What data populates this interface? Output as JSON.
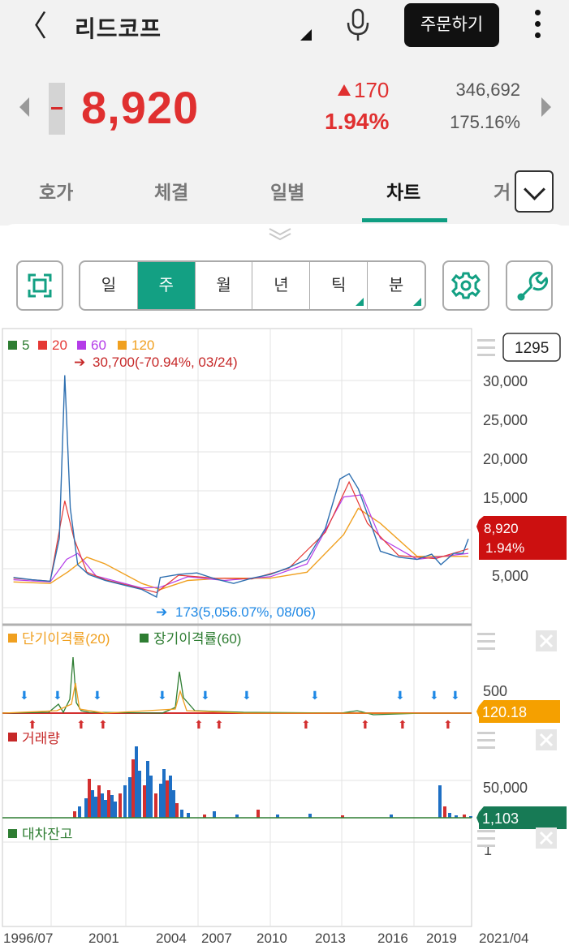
{
  "header": {
    "back_glyph": "〈",
    "stock_name": "리드코프",
    "order_button": "주문하기"
  },
  "quote": {
    "price": "8,920",
    "change": "170",
    "change_pct": "1.94%",
    "volume": "346,692",
    "turnover": "175.16%",
    "color_up": "#e03030"
  },
  "tabs": [
    {
      "label": "호가"
    },
    {
      "label": "체결"
    },
    {
      "label": "일별"
    },
    {
      "label": "차트"
    },
    {
      "label": "거"
    }
  ],
  "active_tab": "차트",
  "toolbar": {
    "periods": [
      "일",
      "주",
      "월",
      "년",
      "틱",
      "분"
    ],
    "active_period": "주",
    "accent": "#13a083"
  },
  "chart": {
    "count_box": "1295",
    "price_panel": {
      "legend": [
        {
          "label": "5",
          "color": "#2e7d32"
        },
        {
          "label": "20",
          "color": "#e53935"
        },
        {
          "label": "60",
          "color": "#b43ce8"
        },
        {
          "label": "120",
          "color": "#f0a020"
        }
      ],
      "high_annotation": "30,700(-70.94%, 03/24)",
      "low_annotation": "173(5,056.07%, 08/06)",
      "y_ticks": [
        "30,000",
        "25,000",
        "20,000",
        "15,000",
        "5,000"
      ],
      "current_price_tag": "8,920",
      "current_pct_tag": "1.94%"
    },
    "disparity_panel": {
      "legend_short": "단기이격률(20)",
      "legend_long": "장기이격률(60)",
      "y_tick": "500",
      "value_tag": "120.18"
    },
    "volume_panel": {
      "legend": "거래량",
      "y_tick": "50,000",
      "value_tag": "1,103"
    },
    "loan_panel": {
      "legend": "대차잔고",
      "y_tick": "1"
    },
    "x_ticks": [
      "1996/07",
      "2001",
      "2004",
      "2007",
      "2010",
      "2013",
      "2016",
      "2019",
      "2021/04"
    ]
  },
  "chart_data": {
    "type": "line",
    "title": "",
    "x_ticks": [
      "1996/07",
      "2001",
      "2004",
      "2007",
      "2010",
      "2013",
      "2016",
      "2019",
      "2021/04"
    ],
    "ylim": [
      0,
      32000
    ],
    "series": [
      {
        "name": "5",
        "x": [
          1996.5,
          1997.5,
          1998.5,
          1999.0,
          1999.3,
          1999.6,
          2000.0,
          2000.6,
          2001.5,
          2002.5,
          2003.5,
          2004.3,
          2004.5,
          2005.5,
          2006.5,
          2007.5,
          2008.5,
          2009.5,
          2010.5,
          2011.5,
          2012.5,
          2013.5,
          2014.3,
          2014.8,
          2015.3,
          2015.8,
          2016.5,
          2017.5,
          2018.5,
          2019.3,
          2019.8,
          2020.5,
          2021.0,
          2021.3
        ],
        "values": [
          3800,
          3500,
          3300,
          9000,
          30700,
          13000,
          5500,
          4200,
          3400,
          2800,
          2200,
          1200,
          3800,
          4200,
          4400,
          3600,
          3000,
          3700,
          4200,
          5100,
          6200,
          10300,
          16900,
          17600,
          15600,
          12200,
          7300,
          6500,
          6200,
          6900,
          5500,
          7000,
          7000,
          8920
        ]
      },
      {
        "name": "20",
        "x": [
          1996.5,
          1998.5,
          1999.3,
          1999.8,
          2000.5,
          2001.5,
          2003.5,
          2004.3,
          2005.5,
          2007.5,
          2009.5,
          2011.5,
          2013.5,
          2014.8,
          2015.8,
          2017.5,
          2019.5,
          2021.3
        ],
        "values": [
          3700,
          3300,
          14000,
          9000,
          4500,
          3500,
          2300,
          1800,
          4100,
          3700,
          3600,
          5000,
          9800,
          16500,
          11000,
          6700,
          6300,
          7600
        ]
      },
      {
        "name": "60",
        "x": [
          1996.5,
          1998.5,
          1999.4,
          2000.0,
          2001.0,
          2003.5,
          2004.5,
          2006.0,
          2008.0,
          2010.5,
          2012.5,
          2014.5,
          2015.5,
          2016.5,
          2018.5,
          2021.3
        ],
        "values": [
          3500,
          3200,
          6200,
          7000,
          4000,
          2400,
          2500,
          3900,
          3400,
          3900,
          5600,
          14500,
          14800,
          9000,
          6200,
          7000
        ]
      },
      {
        "name": "120",
        "x": [
          1996.5,
          1998.5,
          1999.5,
          2000.5,
          2001.5,
          2003.5,
          2004.5,
          2006.0,
          2008.0,
          2010.5,
          2012.5,
          2014.5,
          2015.3,
          2016.5,
          2018.5,
          2021.3
        ],
        "values": [
          3200,
          3000,
          4600,
          6500,
          5600,
          3000,
          2200,
          3400,
          3700,
          3700,
          4500,
          9500,
          13000,
          11000,
          6600,
          6600
        ]
      }
    ]
  }
}
